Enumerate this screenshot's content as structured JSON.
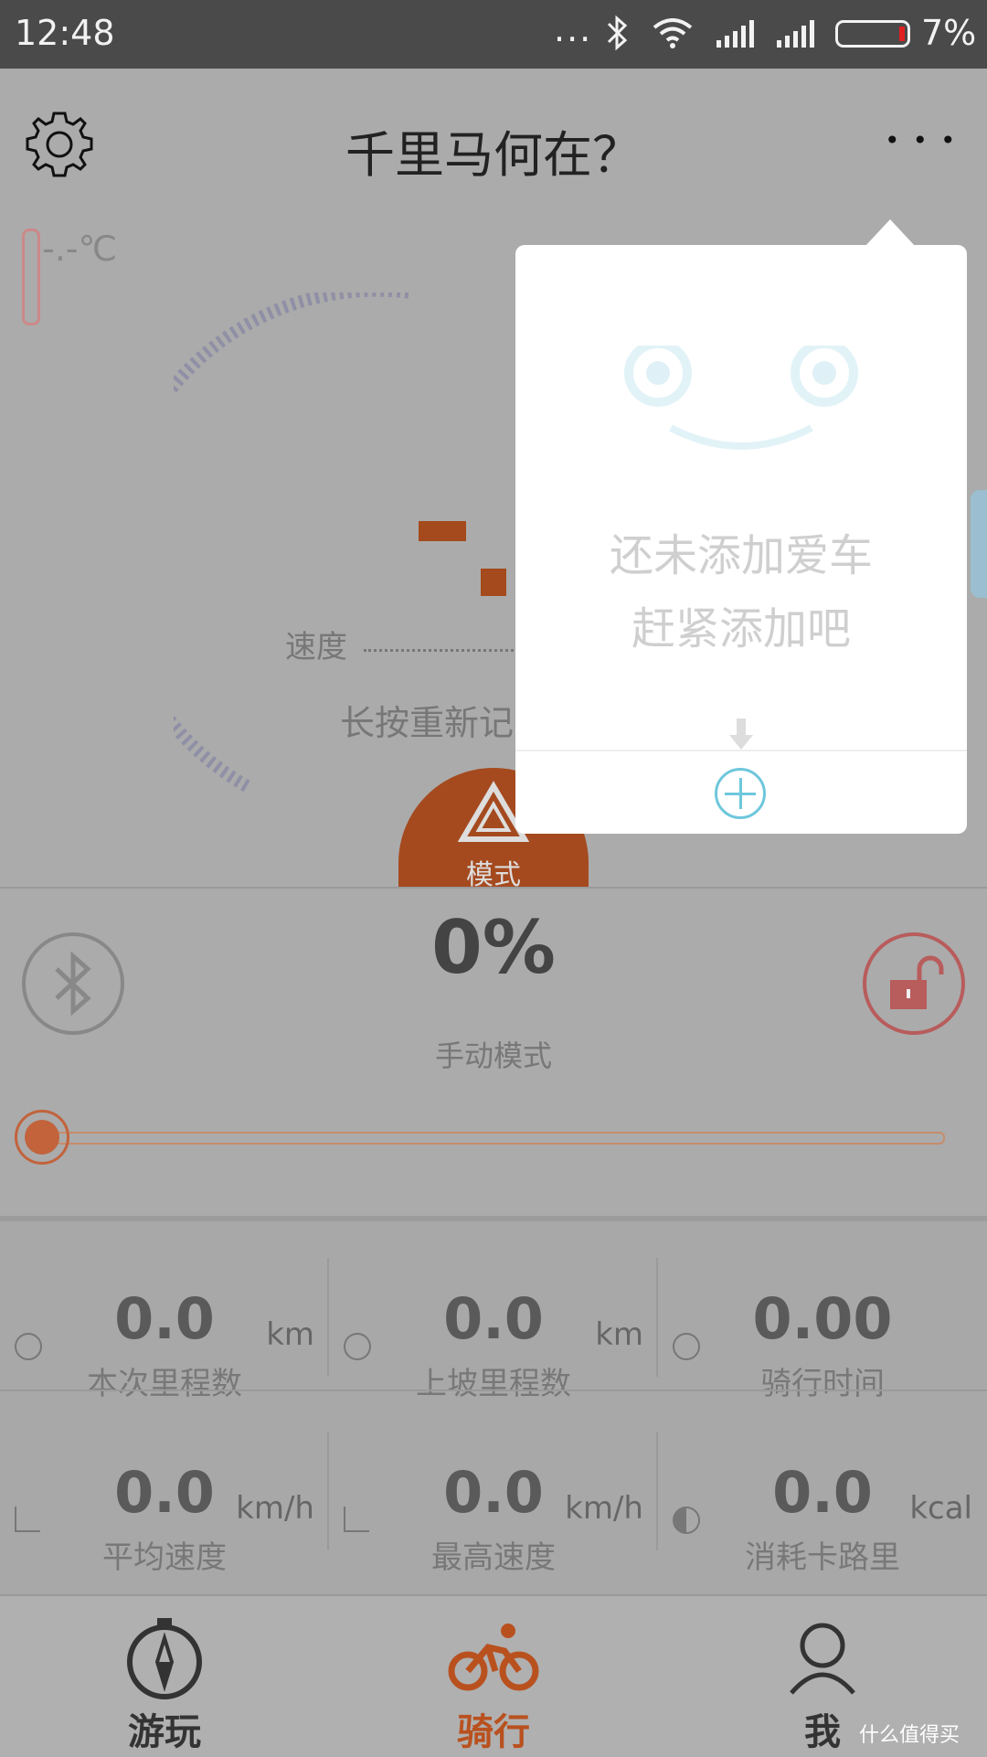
{
  "status_bar": {
    "time": "12:48",
    "dots": "...",
    "battery_pct": "7%"
  },
  "header": {
    "title": "千里马何在？",
    "more": "•••"
  },
  "ride": {
    "temperature": "-.-℃",
    "speed_label": "速度",
    "restart_hint": "长按重新记",
    "mode_label": "模式",
    "assist_pct": "0%",
    "mode_name": "手动模式",
    "slider_value": 0
  },
  "stats": [
    {
      "value": "0.0",
      "unit": "km",
      "label": "本次里程数",
      "icon": "clock-icon"
    },
    {
      "value": "0.0",
      "unit": "km",
      "label": "上坡里程数",
      "icon": "climb-icon"
    },
    {
      "value": "0.00",
      "unit": "",
      "label": "骑行时间",
      "icon": "timer-icon"
    },
    {
      "value": "0.0",
      "unit": "km/h",
      "label": "平均速度",
      "icon": "avg-speed-icon"
    },
    {
      "value": "0.0",
      "unit": "km/h",
      "label": "最高速度",
      "icon": "max-speed-icon"
    },
    {
      "value": "0.0",
      "unit": "kcal",
      "label": "消耗卡路里",
      "icon": "calorie-icon"
    }
  ],
  "tabs": [
    {
      "label": "游玩",
      "icon": "compass-icon",
      "active": false
    },
    {
      "label": "骑行",
      "icon": "bicycle-icon",
      "active": true
    },
    {
      "label": "我",
      "icon": "person-icon",
      "active": false
    }
  ],
  "popup": {
    "line1": "还未添加爱车",
    "line2": "赶紧添加吧"
  },
  "watermark": "什么值得买",
  "colors": {
    "accent": "#b9511f",
    "popup_accent": "#6ec7dc"
  }
}
